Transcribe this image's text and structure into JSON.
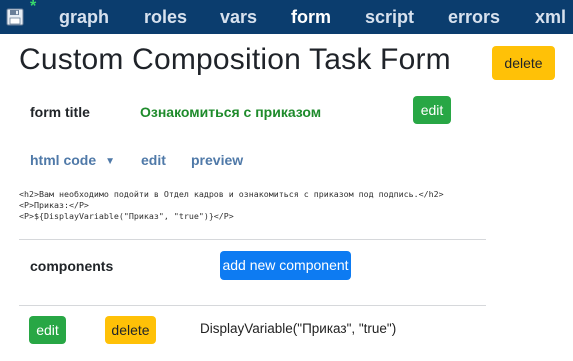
{
  "nav": {
    "save_icon": "floppy-disk-icon",
    "unsaved_marker": "*",
    "items": [
      "graph",
      "roles",
      "vars",
      "form",
      "script",
      "errors",
      "xml"
    ],
    "active": "form"
  },
  "page": {
    "title": "Custom Composition Task Form",
    "delete_label": "delete"
  },
  "form_title": {
    "label": "form title",
    "value": "Ознакомиться с приказом",
    "edit_label": "edit"
  },
  "html_code": {
    "label": "html code",
    "caret": "▼",
    "edit_label": "edit",
    "preview_label": "preview",
    "lines": [
      "<h2>Вам необходимо подойти в Отдел кадров и ознакомиться с приказом под подпись.</h2>",
      "<P>Приказ:</P>",
      "<P>${DisplayVariable(\"Приказ\", \"true\")}</P>"
    ]
  },
  "components": {
    "label": "components",
    "add_label": "add new component",
    "items": [
      {
        "edit_label": "edit",
        "delete_label": "delete",
        "text": "DisplayVariable(\"Приказ\", \"true\")"
      }
    ]
  },
  "colors": {
    "nav_bg": "#0b3d6e",
    "warning": "#ffc107",
    "success": "#28a745",
    "primary": "#0d7bf2",
    "title_green": "#1e8b2b",
    "link": "#4f79a8"
  }
}
